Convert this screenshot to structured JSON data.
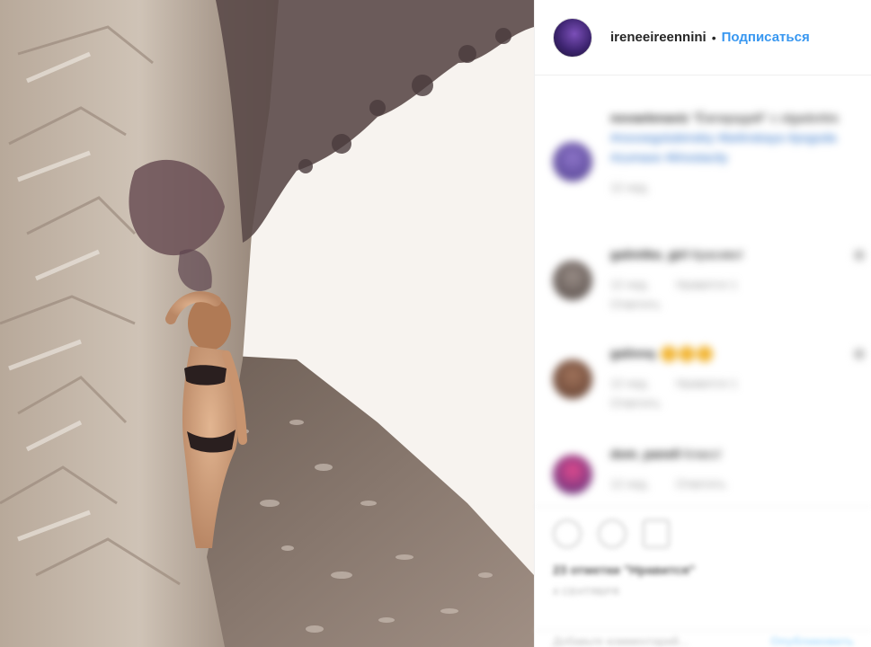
{
  "post": {
    "username": "ireneeireennini",
    "separator": "•",
    "follow_label": "Подписаться"
  },
  "comments": [
    {
      "user": "novaelenaviz",
      "text": "\"Ёжпарадий\" с olgadorbis",
      "link": "#novoegolubinskiy #belinskaya #pogoda #zumaxe #khostacity",
      "time": "12 нед."
    },
    {
      "user": "galinitka_girl",
      "text": "Красиво!",
      "time": "12 нед.",
      "likes": "Нравится 1",
      "reply": "Ответить"
    },
    {
      "user": "galinnq",
      "text": "",
      "emoji_count": 3,
      "time": "12 нед.",
      "likes": "Нравится 1",
      "reply": "Ответить"
    },
    {
      "user": "dom_panell",
      "text": "Класс!",
      "time": "12 нед.",
      "reply": "Ответить"
    }
  ],
  "actions": {
    "likes_text": "23 отметки \"Нравится\"",
    "date_text": "4 СЕНТЯБРЯ",
    "add_comment_placeholder": "Добавьте комментарий...",
    "post_label": "Опубликовать"
  },
  "colors": {
    "link": "#3897f0",
    "text": "#262626",
    "meta": "#999999",
    "border": "#efefef"
  }
}
